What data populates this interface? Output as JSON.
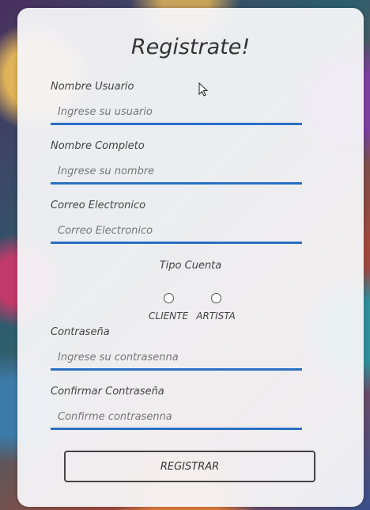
{
  "title": "Registrate!",
  "fields": {
    "usuario": {
      "label": "Nombre Usuario",
      "placeholder": "Ingrese su usuario"
    },
    "nombre": {
      "label": "Nombre Completo",
      "placeholder": "Ingrese su nombre"
    },
    "correo": {
      "label": "Correo Electronico",
      "placeholder": "Correo Electronico"
    },
    "contrasena": {
      "label": "Contraseña",
      "placeholder": "Ingrese su contrasenna"
    },
    "confirmar": {
      "label": "Confirmar Contraseña",
      "placeholder": "Confirme contrasenna"
    }
  },
  "tipo_cuenta": {
    "label": "Tipo Cuenta",
    "options": [
      "CLIENTE",
      "ARTISTA"
    ]
  },
  "submit_label": "REGISTRAR",
  "colors": {
    "accent": "#2a70c4"
  }
}
